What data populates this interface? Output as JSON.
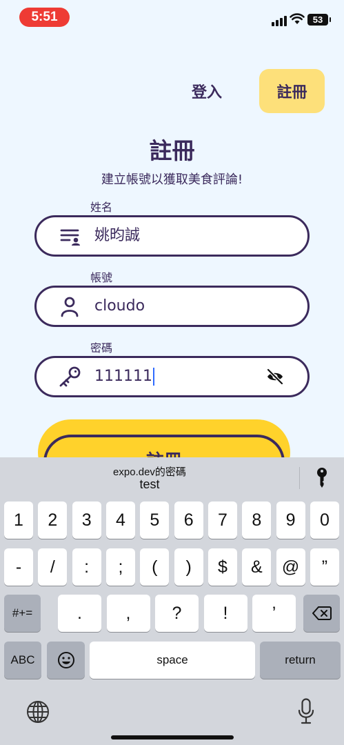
{
  "status_bar": {
    "time": "5:51",
    "battery": "53"
  },
  "tabs": {
    "login": "登入",
    "register": "註冊"
  },
  "header": {
    "title": "註冊",
    "subtitle": "建立帳號以獲取美食評論!"
  },
  "form": {
    "name": {
      "label": "姓名",
      "value": "姚昀誠",
      "icon": "name-list-icon"
    },
    "account": {
      "label": "帳號",
      "value": "cloudo",
      "icon": "user-icon"
    },
    "password": {
      "label": "密碼",
      "value": "111111",
      "icon": "key-icon",
      "toggle_icon": "eye-off-icon"
    }
  },
  "submit_label": "註冊",
  "keyboard": {
    "suggestion": {
      "source": "expo.dev的密碼",
      "value": "test",
      "icon": "key-icon"
    },
    "row1": [
      "1",
      "2",
      "3",
      "4",
      "5",
      "6",
      "7",
      "8",
      "9",
      "0"
    ],
    "row2": [
      "-",
      "/",
      ":",
      ";",
      "(",
      ")",
      "$",
      "&",
      "@",
      "”"
    ],
    "row3": {
      "shift": "#+=",
      "keys": [
        ".",
        ",",
        "?",
        "!",
        "’"
      ],
      "delete_icon": "backspace-icon"
    },
    "row4": {
      "abc": "ABC",
      "emoji_icon": "emoji-icon",
      "space": "space",
      "return": "return"
    },
    "bottom": {
      "globe_icon": "globe-icon",
      "mic_icon": "microphone-icon"
    }
  },
  "colors": {
    "background": "#eef7ff",
    "accent": "#ffd22b",
    "tab_active": "#fde07a",
    "primary_text": "#3b2a5c",
    "status_pill": "#ee3b34"
  }
}
